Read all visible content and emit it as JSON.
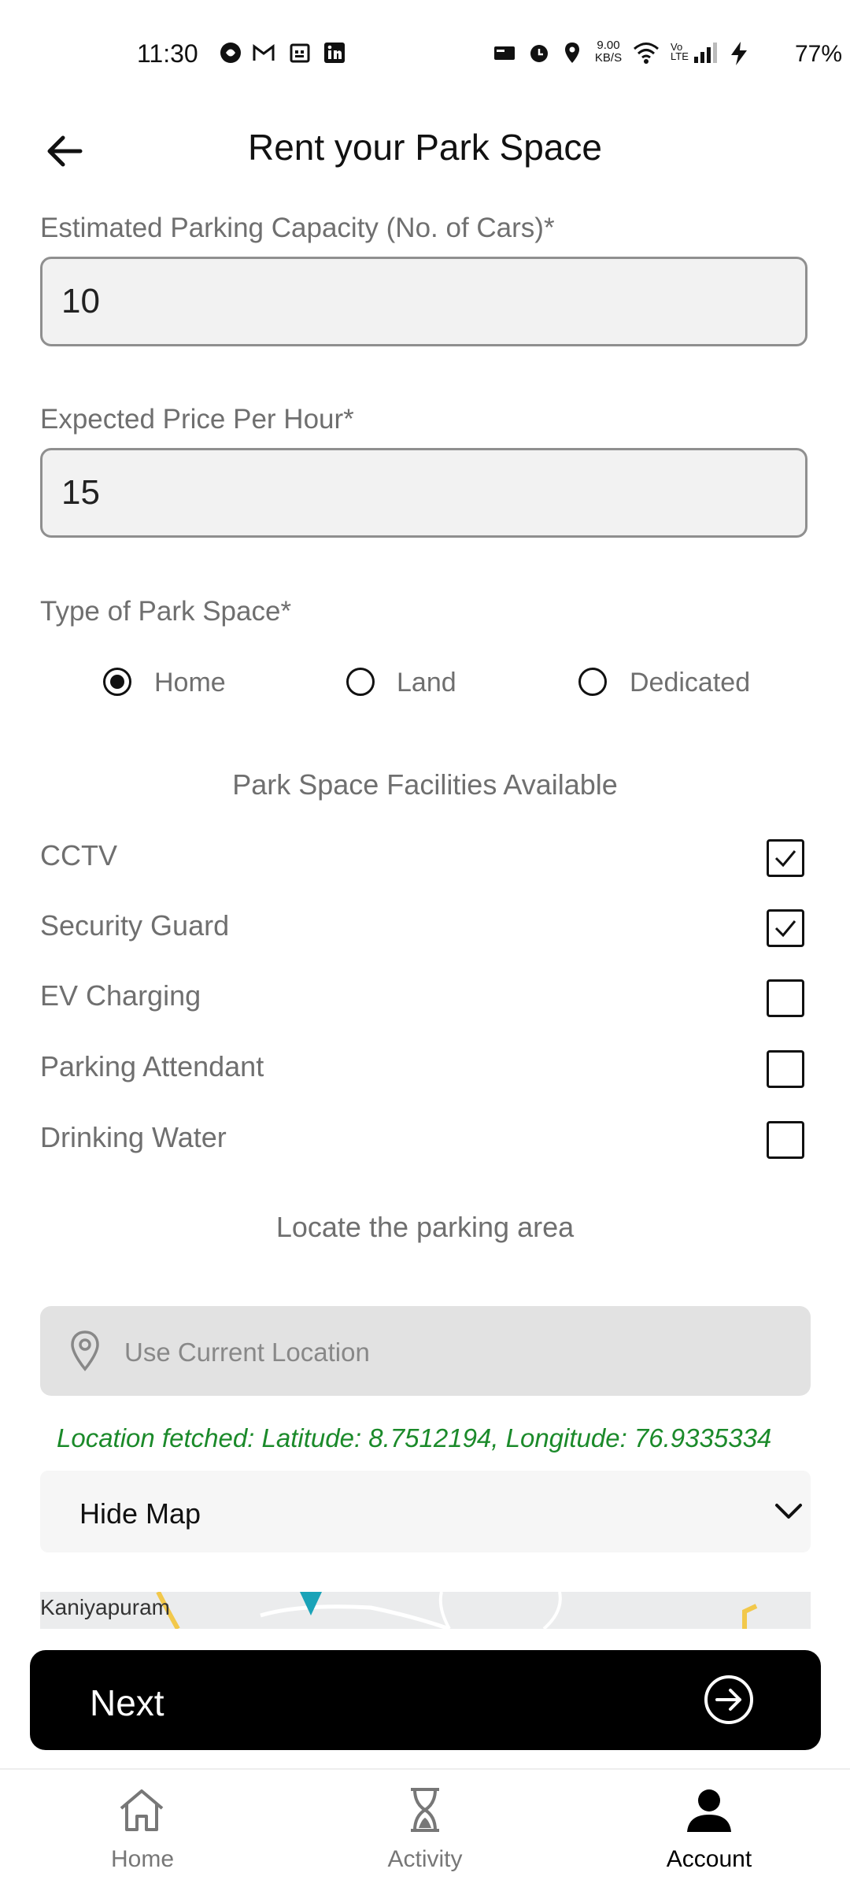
{
  "status_bar": {
    "time": "11:30",
    "battery": "77%",
    "net_speed": "9.00 KB/S"
  },
  "header": {
    "title": "Rent your Park Space"
  },
  "form": {
    "capacity": {
      "label": "Estimated Parking Capacity (No. of Cars)*",
      "value": "10"
    },
    "price": {
      "label": "Expected Price Per Hour*",
      "value": "15"
    },
    "space_type": {
      "label": "Type of Park Space*",
      "options": [
        {
          "label": "Home",
          "selected": true
        },
        {
          "label": "Land",
          "selected": false
        },
        {
          "label": "Dedicated",
          "selected": false
        }
      ]
    },
    "facilities": {
      "title": "Park Space Facilities Available",
      "items": [
        {
          "label": "CCTV",
          "checked": true
        },
        {
          "label": "Security Guard",
          "checked": true
        },
        {
          "label": "EV Charging",
          "checked": false
        },
        {
          "label": "Parking Attendant",
          "checked": false
        },
        {
          "label": "Drinking Water",
          "checked": false
        }
      ]
    },
    "location": {
      "title": "Locate the parking area",
      "placeholder": "Use Current Location",
      "status": "Location fetched: Latitude: 8.7512194, Longitude: 76.9335334",
      "map_toggle": "Hide Map",
      "map_place": "Kaniyapuram"
    }
  },
  "actions": {
    "next_label": "Next"
  },
  "bottom_nav": {
    "items": [
      {
        "label": "Home",
        "icon": "home-icon",
        "active": false
      },
      {
        "label": "Activity",
        "icon": "hourglass-icon",
        "active": false
      },
      {
        "label": "Account",
        "icon": "person-icon",
        "active": true
      }
    ]
  },
  "colors": {
    "accent": "#000000",
    "status_ok": "#1b8a2a",
    "muted_text": "#6f6f6f"
  }
}
